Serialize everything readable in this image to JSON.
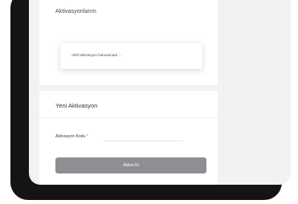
{
  "activations": {
    "title": "Aktivasyonlarım",
    "empty_message": "Aktif aktivasyon bulunamadı ..."
  },
  "new_activation": {
    "title": "Yeni Aktivasyon",
    "code_label": "Aktivasyon Kodu",
    "required_mark": "*",
    "code_value": "",
    "submit_label": "Aktive Et"
  },
  "colors": {
    "button_bg": "#8d8f93",
    "required": "#e24a4a",
    "page_bg": "#f1f2f4"
  }
}
